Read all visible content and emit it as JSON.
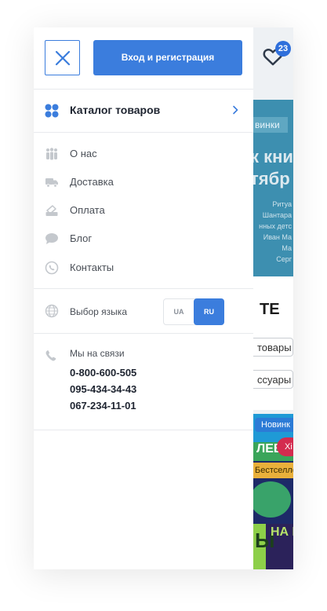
{
  "background_page": {
    "cart_count": "23",
    "banner_tag": "винки",
    "banner_big_line1": "к кни",
    "banner_big_line2": "тябр",
    "banner_small_lines": [
      "Ритуа",
      "Шантара",
      "нных детс",
      "Иван Ма",
      "Ма",
      "Серг"
    ],
    "heading": "ТЕ",
    "buttons": [
      "товары",
      "ссуары"
    ],
    "book_badge_new": "Новинк",
    "book_badge_hit": "Хі",
    "book_title": "ЛЕВИ",
    "book_bestseller": "Бестселле",
    "book_bottom_text": "НА ГОРЫ"
  },
  "drawer": {
    "login_label": "Вход и регистрация",
    "catalog_label": "Каталог товаров",
    "menu": [
      {
        "label": "О нас",
        "icon": "people-icon"
      },
      {
        "label": "Доставка",
        "icon": "truck-icon"
      },
      {
        "label": "Оплата",
        "icon": "payment-icon"
      },
      {
        "label": "Блог",
        "icon": "chat-bubble-icon"
      },
      {
        "label": "Контакты",
        "icon": "whatsapp-icon"
      }
    ],
    "language": {
      "label": "Выбор языка",
      "options": [
        "UA",
        "RU"
      ],
      "selected": "RU"
    },
    "contacts": {
      "title": "Мы на связи",
      "phones": [
        "0-800-600-505",
        "095-434-34-43",
        "067-234-11-01"
      ]
    }
  },
  "colors": {
    "accent": "#3b7ddd",
    "text_dark": "#1e2430",
    "text_muted": "#4a4f57",
    "icon_gray": "#c4c8cd"
  }
}
